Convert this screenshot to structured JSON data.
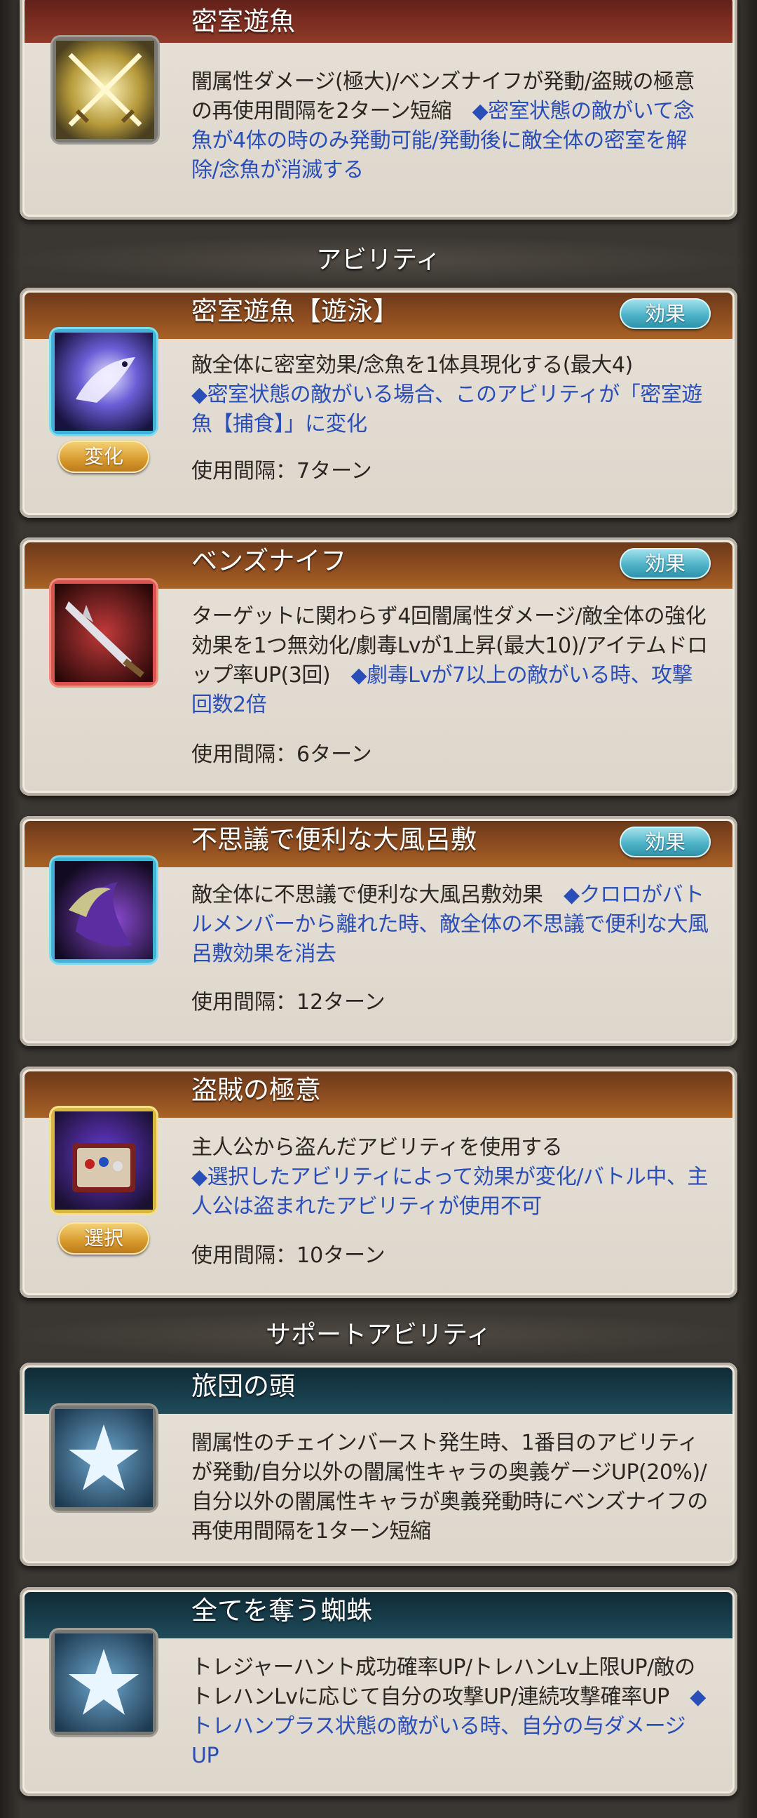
{
  "skill_top": {
    "title": "密室遊魚",
    "desc_plain": "闇属性ダメージ(極大)/ベンズナイフが発動/盗賊の極意の再使用間隔を2ターン短縮　",
    "desc_note": "◆密室状態の敵がいて念魚が4体の時のみ発動可能/発動後に敵全体の密室を解除/念魚が消滅する"
  },
  "sections": {
    "abilities": "アビリティ",
    "support": "サポートアビリティ"
  },
  "abilities": [
    {
      "title": "密室遊魚【遊泳】",
      "button": "効果",
      "tag": "変化",
      "desc_plain": "敵全体に密室効果/念魚を1体具現化する(最大4)",
      "desc_note": "◆密室状態の敵がいる場合、このアビリティが「密室遊魚【捕食】」に変化",
      "interval": "使用間隔：7ターン"
    },
    {
      "title": "ベンズナイフ",
      "button": "効果",
      "desc_plain": "ターゲットに関わらず4回闇属性ダメージ/敵全体の強化効果を1つ無効化/劇毒Lvが1上昇(最大10)/アイテムドロップ率UP(3回)　",
      "desc_note": "◆劇毒Lvが7以上の敵がいる時、攻撃回数2倍",
      "interval": "使用間隔：6ターン"
    },
    {
      "title": "不思議で便利な大風呂敷",
      "button": "効果",
      "desc_plain": "敵全体に不思議で便利な大風呂敷効果　",
      "desc_note": "◆クロロがバトルメンバーから離れた時、敵全体の不思議で便利な大風呂敷効果を消去",
      "interval": "使用間隔：12ターン"
    },
    {
      "title": "盗賊の極意",
      "tag": "選択",
      "desc_plain": "主人公から盗んだアビリティを使用する",
      "desc_note": "◆選択したアビリティによって効果が変化/バトル中、主人公は盗まれたアビリティが使用不可",
      "interval": "使用間隔：10ターン"
    }
  ],
  "supports": [
    {
      "title": "旅団の頭",
      "desc_plain": "闇属性のチェインバースト発生時、1番目のアビリティが発動/自分以外の闇属性キャラの奥義ゲージUP(20%)/自分以外の闇属性キャラが奥義発動時にベンズナイフの再使用間隔を1ターン短縮",
      "desc_note": ""
    },
    {
      "title": "全てを奪う蜘蛛",
      "desc_plain": "トレジャーハント成功確率UP/トレハンLv上限UP/敵のトレハンLvに応じて自分の攻撃UP/連続攻撃確率UP　",
      "desc_note": "◆トレハンプラス状態の敵がいる時、自分の与ダメージUP"
    }
  ]
}
